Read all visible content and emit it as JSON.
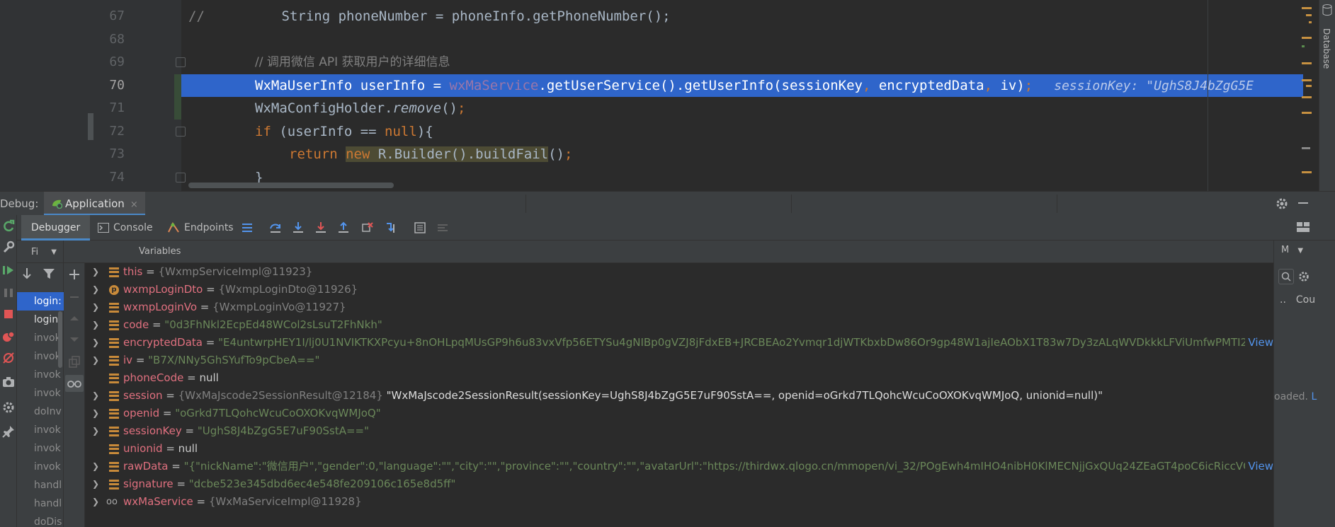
{
  "editor": {
    "lines": [
      {
        "num": "67",
        "prefix": "//",
        "code": "        String phoneNumber = phoneInfo.getPhoneNumber();"
      },
      {
        "num": "68"
      },
      {
        "num": "69",
        "comment": "// 调用微信 API 获取用户的详细信息"
      },
      {
        "num": "70",
        "code_a": "WxMaUserInfo userInfo = ",
        "field": "wxMaService",
        "code_b": ".getUserService().getUserInfo(sessionKey",
        "comma1": ", ",
        "code_c": "encryptedData",
        "comma2": ", ",
        "code_d": "iv)",
        "semi": ";",
        "hint": "sessionKey: \"UghS8J4bZgG5E"
      },
      {
        "num": "71",
        "code_a": "WxMaConfigHolder.",
        "method": "remove",
        "code_b": "()",
        "semi": ";"
      },
      {
        "num": "72",
        "kw": "if",
        "code": " (userInfo == ",
        "null": "null",
        "code_b": "){"
      },
      {
        "num": "73",
        "kw": "return",
        "new_kw": "new",
        "builder": " R.Builder().buildFail",
        "code_b": "()",
        "semi": ";"
      },
      {
        "num": "74",
        "code": "}"
      }
    ],
    "right_strip_label": "Database"
  },
  "debug": {
    "label": "Debug:",
    "session_tab": "Application",
    "close_glyph": "×",
    "subtabs": {
      "debugger": "Debugger",
      "console": "Console",
      "endpoints": "Endpoints"
    },
    "frames": {
      "dropdown": "Fi",
      "items": [
        "login:",
        "login:",
        "invok",
        "invok",
        "invok",
        "invok",
        "doInv",
        "invok",
        "invok",
        "invok",
        "handl",
        "handl",
        "doDis"
      ]
    },
    "variables": {
      "title": "Variables",
      "rows": [
        {
          "name": "this",
          "eq": " = ",
          "obj": "{WxmpServiceImpl@11923}",
          "icon": "field",
          "expand": true
        },
        {
          "name": "wxmpLoginDto",
          "eq": " = ",
          "obj": "{WxmpLoginDto@11926}",
          "icon": "param",
          "expand": true
        },
        {
          "name": "wxmpLoginVo",
          "eq": " = ",
          "obj": "{WxmpLoginVo@11927}",
          "icon": "field",
          "expand": true
        },
        {
          "name": "code",
          "eq": " = ",
          "str": "\"0d3FhNkl2EcpEd48WCol2sLsuT2FhNkh\"",
          "icon": "field",
          "expand": true
        },
        {
          "name": "encryptedData",
          "eq": " = ",
          "str": "\"E4untwrpHEY1I/lj0U1NVIKTKXPcyu+8nOHLpqMUsGP9h6u83vxVfp56ETYSu4gNIBp0gVZJ8jFdxEB+JRCBEAo2Yvmqr1djWTKbxbDw86Or9gp48W1ajIeAObX1T83w7Dy3zALqWVDkkkLFViUmfwPMTI2FMI...",
          "icon": "field",
          "expand": true,
          "view": "View"
        },
        {
          "name": "iv",
          "eq": " = ",
          "str": "\"B7X/NNy5GhSYufTo9pCbeA==\"",
          "icon": "field",
          "expand": true
        },
        {
          "name": "phoneCode",
          "eq": " = ",
          "null": "null",
          "icon": "field",
          "expand": false
        },
        {
          "name": "session",
          "eq": " = ",
          "obj": "{WxMaJscode2SessionResult@12184}",
          "desc": " \"WxMaJscode2SessionResult(sessionKey=UghS8J4bZgG5E7uF90SstA==, openid=oGrkd7TLQohcWcuCoOXOKvqWMJoQ, unionid=null)\"",
          "icon": "field",
          "expand": true
        },
        {
          "name": "openid",
          "eq": " = ",
          "str": "\"oGrkd7TLQohcWcuCoOXOKvqWMJoQ\"",
          "icon": "field",
          "expand": true
        },
        {
          "name": "sessionKey",
          "eq": " = ",
          "str": "\"UghS8J4bZgG5E7uF90SstA==\"",
          "icon": "field",
          "expand": true
        },
        {
          "name": "unionid",
          "eq": " = ",
          "null": "null",
          "icon": "field",
          "expand": false
        },
        {
          "name": "rawData",
          "eq": " = ",
          "str": "\"{\"nickName\":\"微信用户\",\"gender\":0,\"language\":\"\",\"city\":\"\",\"province\":\"\",\"country\":\"\",\"avatarUrl\":\"https://thirdwx.qlogo.cn/mmopen/vi_32/POgEwh4mIHO4nibH0KlMECNjjGxQUq24ZEaGT4poC6icRiccVGKSy...",
          "icon": "field",
          "expand": true,
          "view": "View"
        },
        {
          "name": "signature",
          "eq": " = ",
          "str": "\"dcbe523e345dbd6ec4e548fe209106c165e8d5ff\"",
          "icon": "field",
          "expand": true
        },
        {
          "name": "wxMaService",
          "eq": " = ",
          "obj": "{WxMaServiceImpl@11928}",
          "icon": "watch",
          "expand": true
        }
      ]
    },
    "right_pane": {
      "dropdown": "M",
      "column": "Cou",
      "loaded": "oaded.",
      "loaded_link": "L"
    }
  },
  "colors": {
    "accent": "#2f65ca",
    "string": "#6a8759",
    "var_name": "#e0707f",
    "keyword": "#cc7832"
  }
}
